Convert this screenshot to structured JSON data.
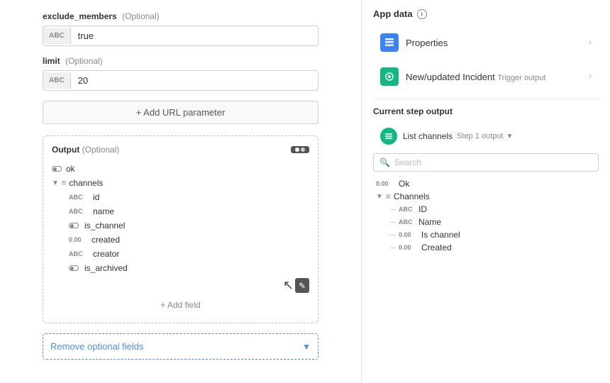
{
  "left": {
    "exclude_members": {
      "label": "exclude_members",
      "optional": "(Optional)",
      "type_badge": "ABC",
      "value": "true"
    },
    "limit": {
      "label": "limit",
      "optional": "(Optional)",
      "type_badge": "ABC",
      "value": "20"
    },
    "add_url_btn": "+ Add URL parameter",
    "output": {
      "label": "Output",
      "optional": "(Optional)",
      "items": [
        {
          "type": "bool",
          "name": "ok",
          "indent": 0
        },
        {
          "type": "lines",
          "name": "channels",
          "indent": 0,
          "expand": true
        },
        {
          "type": "abc",
          "name": "id",
          "indent": 1
        },
        {
          "type": "abc",
          "name": "name",
          "indent": 1
        },
        {
          "type": "bool",
          "name": "is_channel",
          "indent": 1
        },
        {
          "type": "num",
          "name": "created",
          "indent": 1
        },
        {
          "type": "abc",
          "name": "creator",
          "indent": 1
        },
        {
          "type": "bool",
          "name": "is_archived",
          "indent": 1
        }
      ],
      "add_field": "+ Add field"
    },
    "remove_optional_btn": "Remove optional fields"
  },
  "right": {
    "app_data": {
      "title": "App data",
      "info": "i",
      "items": [
        {
          "icon": "table-icon",
          "icon_color": "blue",
          "label": "Properties",
          "has_arrow": true
        },
        {
          "icon": "incident-icon",
          "icon_color": "green",
          "label": "New/updated Incident",
          "sub": "Trigger output",
          "has_arrow": true
        }
      ]
    },
    "current_step": {
      "title": "Current step output",
      "step_label": "List channels",
      "step_sub": "Step 1 output",
      "search_placeholder": "Search",
      "items": [
        {
          "type": "num",
          "name": "Ok",
          "indent": 0
        },
        {
          "type": "lines",
          "name": "Channels",
          "indent": 0,
          "expand": true
        },
        {
          "type": "abc",
          "name": "ID",
          "indent": 1
        },
        {
          "type": "abc",
          "name": "Name",
          "indent": 1
        },
        {
          "type": "num",
          "name": "Is channel",
          "indent": 1
        },
        {
          "type": "num",
          "name": "Created",
          "indent": 1
        }
      ]
    }
  }
}
